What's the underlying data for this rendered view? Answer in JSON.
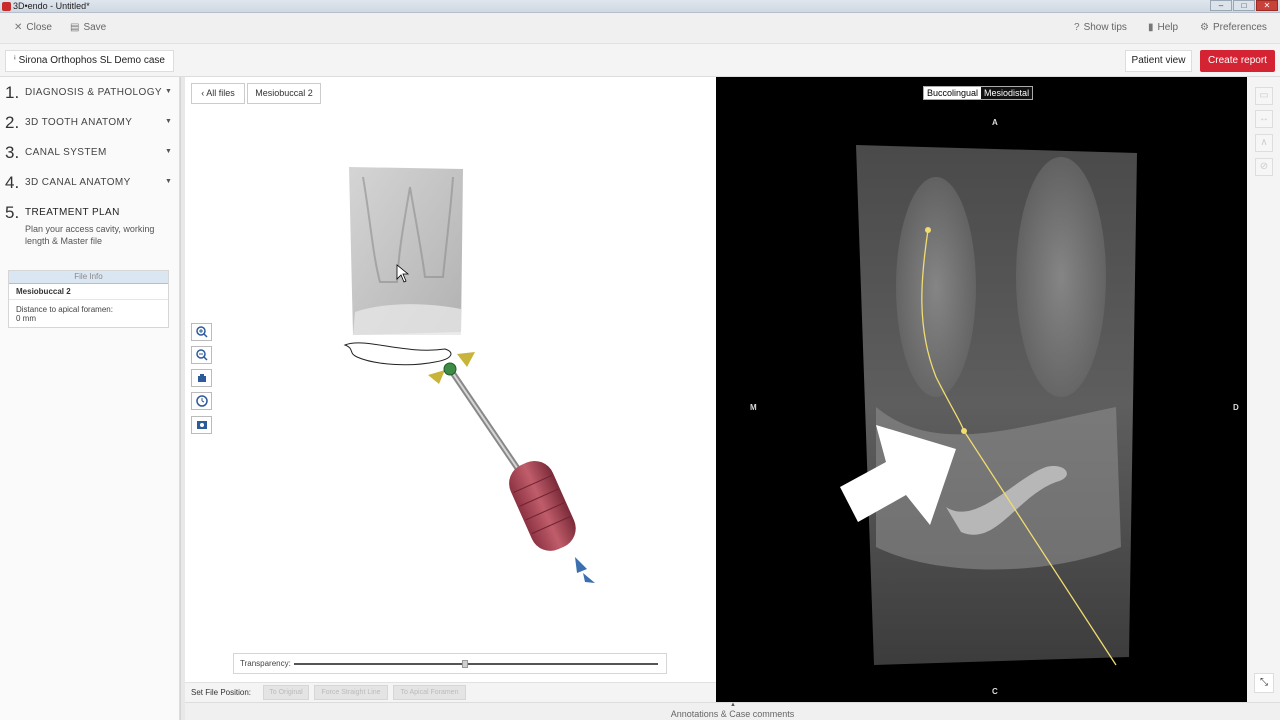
{
  "window": {
    "title": "3D•endo - Untitled*",
    "buttons": [
      "–",
      "□",
      "✕"
    ]
  },
  "toolbar": {
    "close_label": "Close",
    "save_label": "Save",
    "show_tips_label": "Show tips",
    "help_label": "Help",
    "preferences_label": "Preferences"
  },
  "case": {
    "name": "Sirona Orthophos SL Demo case",
    "patient_view_label": "Patient view",
    "create_report_label": "Create report"
  },
  "steps": [
    {
      "num": "1.",
      "label": "DIAGNOSIS & PATHOLOGY"
    },
    {
      "num": "2.",
      "label": "3D TOOTH ANATOMY"
    },
    {
      "num": "3.",
      "label": "CANAL SYSTEM"
    },
    {
      "num": "4.",
      "label": "3D CANAL ANATOMY"
    },
    {
      "num": "5.",
      "label": "TREATMENT PLAN",
      "description": "Plan your access cavity, working length & Master file"
    }
  ],
  "file_info": {
    "header": "File Info",
    "file_name": "Mesiobuccal 2",
    "distance_label": "Distance to apical foramen:",
    "distance_value": "0 mm"
  },
  "left_view": {
    "all_files_label": "All files",
    "current_file_label": "Mesiobuccal 2",
    "transparency_label": "Transparency:",
    "transparency_value": 0.47
  },
  "set_file_position": {
    "label": "Set File Position:",
    "buttons": [
      "To Original",
      "Force Straight Line",
      "To Apical Foramen"
    ]
  },
  "right_view": {
    "tabs": [
      "Buccolingual",
      "Mesiodistal"
    ],
    "active_tab": "Buccolingual",
    "orientation": {
      "top": "A",
      "left": "M",
      "right": "D",
      "bottom": "C"
    }
  },
  "annotations_label": "Annotations & Case comments",
  "colors": {
    "accent_red": "#d42332",
    "canal_path": "#f0dc70",
    "file_handle": "#b4525f"
  }
}
